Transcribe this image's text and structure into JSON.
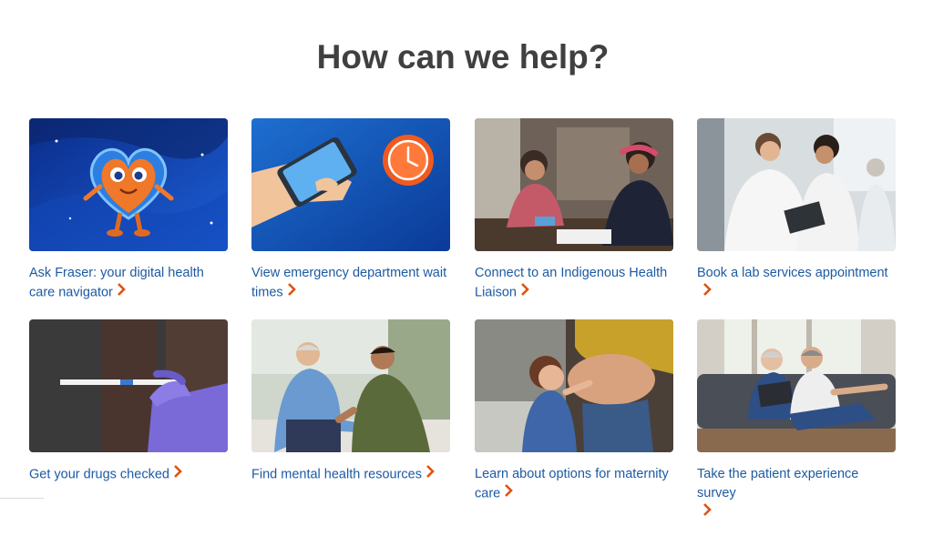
{
  "heading": "How can we help?",
  "accent_color": "#e0520f",
  "link_color": "#1c5aa3",
  "cards": [
    {
      "label": "Ask Fraser: your digital health care navigator",
      "image": "heart-mascot-image"
    },
    {
      "label": "View emergency department wait times",
      "image": "phone-clock-image"
    },
    {
      "label": "Connect to an Indigenous Health Liaison",
      "image": "liaison-meeting-image"
    },
    {
      "label": "Book a lab services appointment",
      "image": "lab-staff-image"
    },
    {
      "label": "Get your drugs checked",
      "image": "test-strip-image"
    },
    {
      "label": "Find mental health resources",
      "image": "counseling-image"
    },
    {
      "label": "Learn about options for maternity care",
      "image": "maternity-image"
    },
    {
      "label": "Take the patient experience survey",
      "image": "couple-tablet-image"
    }
  ]
}
